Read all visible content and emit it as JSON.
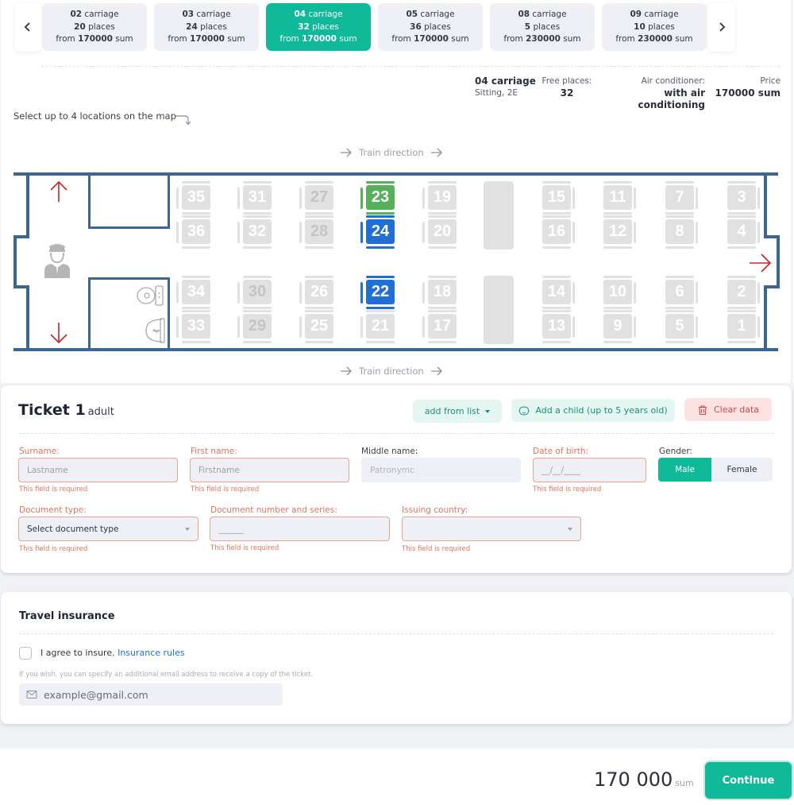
{
  "carriages": {
    "prev_icon": "chevron-left-icon",
    "next_icon": "chevron-right-icon",
    "tabs": [
      {
        "number": "02",
        "carriage_word": "carriage",
        "places": "20",
        "places_word": "places",
        "from_word": "from",
        "price": "170000",
        "currency": "sum",
        "active": false
      },
      {
        "number": "03",
        "carriage_word": "carriage",
        "places": "24",
        "places_word": "places",
        "from_word": "from",
        "price": "170000",
        "currency": "sum",
        "active": false
      },
      {
        "number": "04",
        "carriage_word": "carriage",
        "places": "32",
        "places_word": "places",
        "from_word": "from",
        "price": "170000",
        "currency": "sum",
        "active": true
      },
      {
        "number": "05",
        "carriage_word": "carriage",
        "places": "36",
        "places_word": "places",
        "from_word": "from",
        "price": "170000",
        "currency": "sum",
        "active": false
      },
      {
        "number": "08",
        "carriage_word": "carriage",
        "places": "5",
        "places_word": "places",
        "from_word": "from",
        "price": "230000",
        "currency": "sum",
        "active": false
      },
      {
        "number": "09",
        "carriage_word": "carriage",
        "places": "10",
        "places_word": "places",
        "from_word": "from",
        "price": "230000",
        "currency": "sum",
        "active": false
      }
    ]
  },
  "carriage_info": {
    "name": "04 carriage",
    "type": "Sitting, 2E",
    "free_label": "Free places:",
    "free_value": "32",
    "ac_label": "Air conditioner:",
    "ac_value": "with air conditioning",
    "price_label": "Price",
    "price_value": "170000 sum"
  },
  "map": {
    "hint": "Select up to 4 locations on the map",
    "direction_label": "Train direction",
    "seats_upper": [
      {
        "top": "35",
        "bottom": "36",
        "top_state": "free",
        "bottom_state": "free"
      },
      {
        "top": "31",
        "bottom": "32",
        "top_state": "free",
        "bottom_state": "free"
      },
      {
        "top": "27",
        "bottom": "28",
        "top_state": "dim",
        "bottom_state": "dim"
      },
      {
        "top": "23",
        "bottom": "24",
        "top_state": "green",
        "bottom_state": "blue"
      },
      {
        "top": "19",
        "bottom": "20",
        "top_state": "free",
        "bottom_state": "free"
      },
      {
        "top": "15",
        "bottom": "16",
        "top_state": "free",
        "bottom_state": "free"
      },
      {
        "top": "11",
        "bottom": "12",
        "top_state": "free",
        "bottom_state": "free"
      },
      {
        "top": "7",
        "bottom": "8",
        "top_state": "free",
        "bottom_state": "free"
      },
      {
        "top": "3",
        "bottom": "4",
        "top_state": "free",
        "bottom_state": "free"
      }
    ],
    "seats_lower": [
      {
        "top": "34",
        "bottom": "33",
        "top_state": "free",
        "bottom_state": "free"
      },
      {
        "top": "30",
        "bottom": "29",
        "top_state": "dim",
        "bottom_state": "dim"
      },
      {
        "top": "26",
        "bottom": "25",
        "top_state": "free",
        "bottom_state": "free"
      },
      {
        "top": "22",
        "bottom": "21",
        "top_state": "blue",
        "bottom_state": "free"
      },
      {
        "top": "18",
        "bottom": "17",
        "top_state": "free",
        "bottom_state": "free"
      },
      {
        "top": "14",
        "bottom": "13",
        "top_state": "free",
        "bottom_state": "free"
      },
      {
        "top": "10",
        "bottom": "9",
        "top_state": "free",
        "bottom_state": "free"
      },
      {
        "top": "6",
        "bottom": "5",
        "top_state": "free",
        "bottom_state": "free"
      },
      {
        "top": "2",
        "bottom": "1",
        "top_state": "free",
        "bottom_state": "free"
      }
    ],
    "colors": {
      "wall": "#3a6595",
      "seat": "#e1e1e1",
      "selected_green": "#57b05a",
      "selected_blue": "#1f6fd6",
      "exit_arrow": "#d0212a"
    }
  },
  "ticket": {
    "title": "Ticket 1",
    "subtitle": "adult",
    "add_from_list": "add from list",
    "add_child": "Add a child (up to 5 years old)",
    "clear_data": "Clear data",
    "fields": {
      "surname": {
        "label": "Surname:",
        "placeholder": "Lastname",
        "error": "This field is required"
      },
      "first_name": {
        "label": "First name:",
        "placeholder": "Firstname",
        "error": "This field is required"
      },
      "middle_name": {
        "label": "Middle name:",
        "placeholder": "Patronymc"
      },
      "dob": {
        "label": "Date of birth:",
        "placeholder": "__/__/____",
        "error": "This field is required"
      },
      "gender": {
        "label": "Gender:",
        "options": [
          "Male",
          "Female"
        ],
        "selected": "Male"
      },
      "doc_type": {
        "label": "Document type:",
        "value": "Select document type",
        "error": "This field is required"
      },
      "doc_number": {
        "label": "Document number and series:",
        "placeholder": "______",
        "error": "This field is required"
      },
      "country": {
        "label": "Issuing country:",
        "value": "",
        "error": "This field is required"
      }
    }
  },
  "insurance": {
    "title": "Travel insurance",
    "agree_text": "I agree to insure.",
    "rules_link": "Insurance rules",
    "checked": false,
    "note": "If you wish, you can specify an additional email address to receive a copy of the ticket.",
    "email_placeholder": "example@gmail.com"
  },
  "footer": {
    "total": "170 000",
    "currency": "sum",
    "continue_label": "Continue"
  },
  "colors": {
    "accent": "#10b99a",
    "error": "#e0735f",
    "danger_bg": "#fde2e2",
    "mint_bg": "#e3f6f2"
  }
}
